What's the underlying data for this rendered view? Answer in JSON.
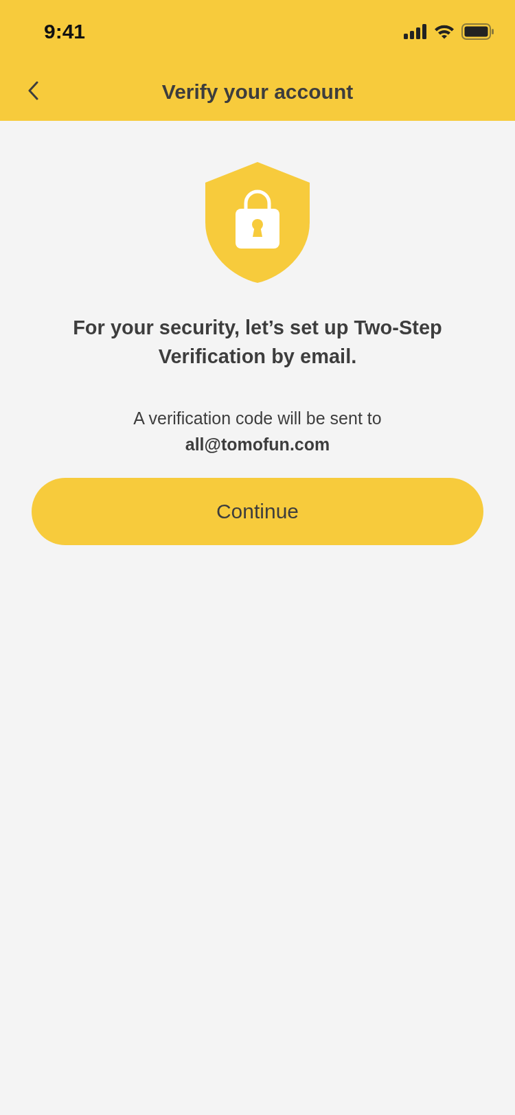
{
  "status_bar": {
    "time": "9:41"
  },
  "nav_bar": {
    "title": "Verify your account"
  },
  "heading": "For your security, let’s set up Two-Step Verification by email.",
  "message": "A verification code will be sent to",
  "email": "all@tomofun.com",
  "buttons": [
    {
      "label": "Continue",
      "kind": "primary"
    }
  ]
}
